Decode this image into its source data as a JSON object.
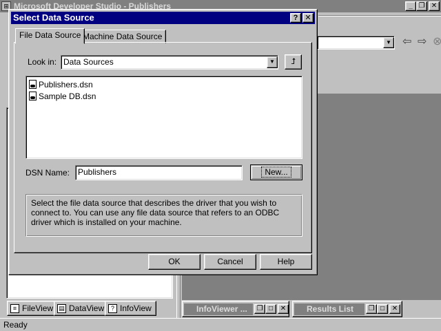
{
  "app": {
    "title": "Microsoft Developer Studio - Publishers",
    "status": "Ready",
    "bottom_tabs": [
      {
        "label": "FileView"
      },
      {
        "label": "DataView"
      },
      {
        "label": "InfoView"
      }
    ],
    "docked": [
      {
        "title": "InfoViewer ..."
      },
      {
        "title": "Results List"
      }
    ]
  },
  "dialog": {
    "title": "Select Data Source",
    "tabs": [
      {
        "label": "File Data Source",
        "active": true
      },
      {
        "label": "Machine Data Source",
        "active": false
      }
    ],
    "look_in_label": "Look in:",
    "look_in_value": "Data Sources",
    "files": [
      {
        "name": "Publishers.dsn"
      },
      {
        "name": "Sample DB.dsn"
      }
    ],
    "dsn_label": "DSN Name:",
    "dsn_value": "Publishers",
    "new_label": "New...",
    "description": "Select the file data source that describes the driver that you wish to connect to. You can use any file data source that refers to an ODBC driver which is installed on your machine.",
    "ok_label": "OK",
    "cancel_label": "Cancel",
    "help_label": "Help"
  }
}
